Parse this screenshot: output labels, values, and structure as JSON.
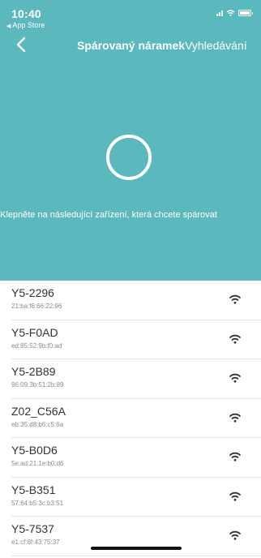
{
  "status_bar": {
    "time": "10:40",
    "back_app": "App Store"
  },
  "nav": {
    "title_bold": "Spárovaný náramek",
    "title_rest": "Vyhledávání"
  },
  "hint": "Klepněte na následující zařízení, která chcete spárovat",
  "colors": {
    "header_bg": "#5bb8bd",
    "accent": "#ffffff"
  },
  "devices": [
    {
      "name": "Y5-2296",
      "mac": "21:ba:f6:66:22:96"
    },
    {
      "name": "Y5-F0AD",
      "mac": "ed:85:52:9b:f0:ad"
    },
    {
      "name": "Y5-2B89",
      "mac": "96:09:3b:51:2b:89"
    },
    {
      "name": "Z02_C56A",
      "mac": "eb:35:d8:b6:c5:6a"
    },
    {
      "name": "Y5-B0D6",
      "mac": "5e:ad:21:1e:b0:d6"
    },
    {
      "name": "Y5-B351",
      "mac": "57:64:b5:3c:b3:51"
    },
    {
      "name": "Y5-7537",
      "mac": "e1:cf:8f:43:75:37"
    }
  ]
}
